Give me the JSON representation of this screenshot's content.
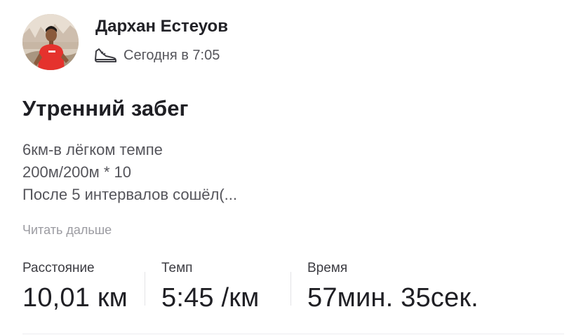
{
  "post": {
    "author": {
      "name": "Дархан Естеуов",
      "avatar_icon": "user-photo"
    },
    "meta": {
      "activity_icon": "running-shoe-icon",
      "timestamp": "Сегодня в 7:05"
    },
    "title": "Утренний забег",
    "description_lines": [
      "6км-в лёгком темпе",
      "200м/200м * 10",
      "После 5 интервалов сошёл(..."
    ],
    "read_more": "Читать дальше",
    "stats": {
      "distance": {
        "label": "Расстояние",
        "value": "10,01 км"
      },
      "pace": {
        "label": "Темп",
        "value": "5:45 /км"
      },
      "time": {
        "label": "Время",
        "value": "57мин. 35сек."
      }
    }
  },
  "colors": {
    "text_primary": "#1f1f24",
    "text_secondary": "#55555b",
    "text_muted": "#9b9ba1",
    "shirt_red": "#e5322d"
  }
}
